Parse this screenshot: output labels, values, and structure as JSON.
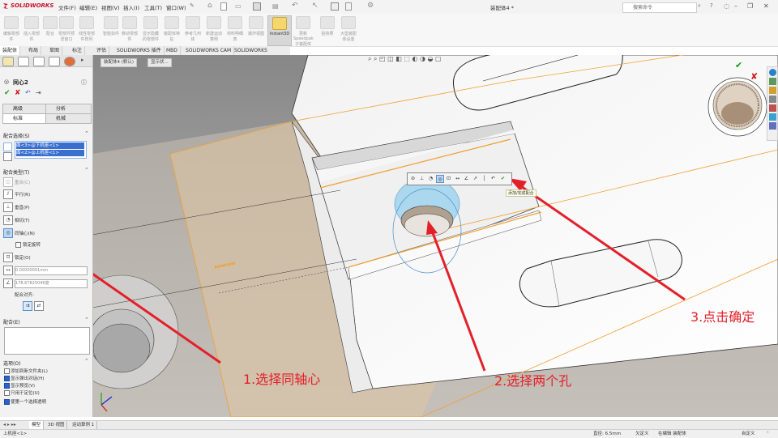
{
  "app": {
    "logo": "SOLIDWORKS",
    "title": "装配体4 *"
  },
  "menu": [
    {
      "id": "file",
      "label": "文件(F)"
    },
    {
      "id": "edit",
      "label": "编辑(E)"
    },
    {
      "id": "view",
      "label": "视图(V)"
    },
    {
      "id": "insert",
      "label": "插入(I)"
    },
    {
      "id": "tools",
      "label": "工具(T)"
    },
    {
      "id": "window",
      "label": "窗口(W)"
    }
  ],
  "search": {
    "placeholder": "搜索命令"
  },
  "ribbon": {
    "buttons": [
      {
        "label": "编辑零部件"
      },
      {
        "label": "插入零部件"
      },
      {
        "label": "配合"
      },
      {
        "label": "零部件预览窗口"
      },
      {
        "label": "线性零部件阵列"
      },
      {
        "label": "智能扣件"
      },
      {
        "label": "移动零部件"
      },
      {
        "label": "显示隐藏的零部件"
      },
      {
        "label": "装配体特征"
      },
      {
        "label": "参考几何体"
      },
      {
        "label": "新建运动算例"
      },
      {
        "label": "材料明细表"
      },
      {
        "label": "爆炸视图"
      },
      {
        "label": "Instant3D"
      },
      {
        "label": "更新Speedpak子装配体"
      },
      {
        "label": "拍快照"
      },
      {
        "label": "大型装配体设置"
      }
    ]
  },
  "commandTabs": [
    {
      "label": "装配体",
      "active": true
    },
    {
      "label": "布局"
    },
    {
      "label": "草图"
    },
    {
      "label": "标注"
    },
    {
      "label": "评估"
    },
    {
      "label": "SOLIDWORKS 插件"
    },
    {
      "label": "MBD"
    },
    {
      "label": "SOLIDWORKS CAM"
    },
    {
      "label": "SOLIDWORKS Inspection"
    }
  ],
  "pm": {
    "title": "同心2",
    "tabs": {
      "advanced": "高级",
      "analysis": "分析",
      "standard": "标准",
      "mechanical": "机械"
    },
    "selections": {
      "header": "配合选择(S)",
      "items": [
        "面<3>@下机座<1>",
        "面<2>@上机座<1>"
      ]
    },
    "mateTypes": {
      "header": "配合类型(T)",
      "items": [
        {
          "label": "重合(C)",
          "disabled": true
        },
        {
          "label": "平行(R)"
        },
        {
          "label": "垂直(P)"
        },
        {
          "label": "相切(T)"
        },
        {
          "label": "同轴心(N)"
        },
        {
          "label": "锁定旋转"
        },
        {
          "label": "锁定(O)"
        }
      ],
      "distance": "0.00000001mm",
      "angle": "178.67825046度",
      "alignLabel": "配合对齐:"
    },
    "mates": {
      "header": "配合(E)"
    },
    "options": {
      "header": "选项(O)",
      "items": [
        {
          "label": "添加到新文件夹(L)",
          "checked": false
        },
        {
          "label": "显示弹出对话(H)",
          "checked": true
        },
        {
          "label": "显示预览(V)",
          "checked": true
        },
        {
          "label": "只用于定位(U)",
          "checked": false
        },
        {
          "label": "使第一个选择透明",
          "checked": true
        }
      ]
    }
  },
  "viewport": {
    "breadcrumb": [
      "装配体4 (默认)",
      "显示状..."
    ],
    "popupTooltip": "添加/完成配合"
  },
  "annotations": {
    "step1": "1.选择同轴心",
    "step2": "2.选择两个孔",
    "step3": "3.点击确定"
  },
  "bottomTabs": [
    {
      "label": "模型",
      "active": true
    },
    {
      "label": "3D 视图"
    },
    {
      "label": "运动算例 1"
    }
  ],
  "status": {
    "left": "上机座<1>",
    "diameter": "直径: 6.5mm",
    "defined": "欠定义",
    "editing": "在编辑 装配体",
    "custom": "自定义"
  },
  "colors": {
    "accent": "#e3202a",
    "selection": "#3a6fd0",
    "edge": "#f0a030",
    "check": "#1a9a1a"
  }
}
